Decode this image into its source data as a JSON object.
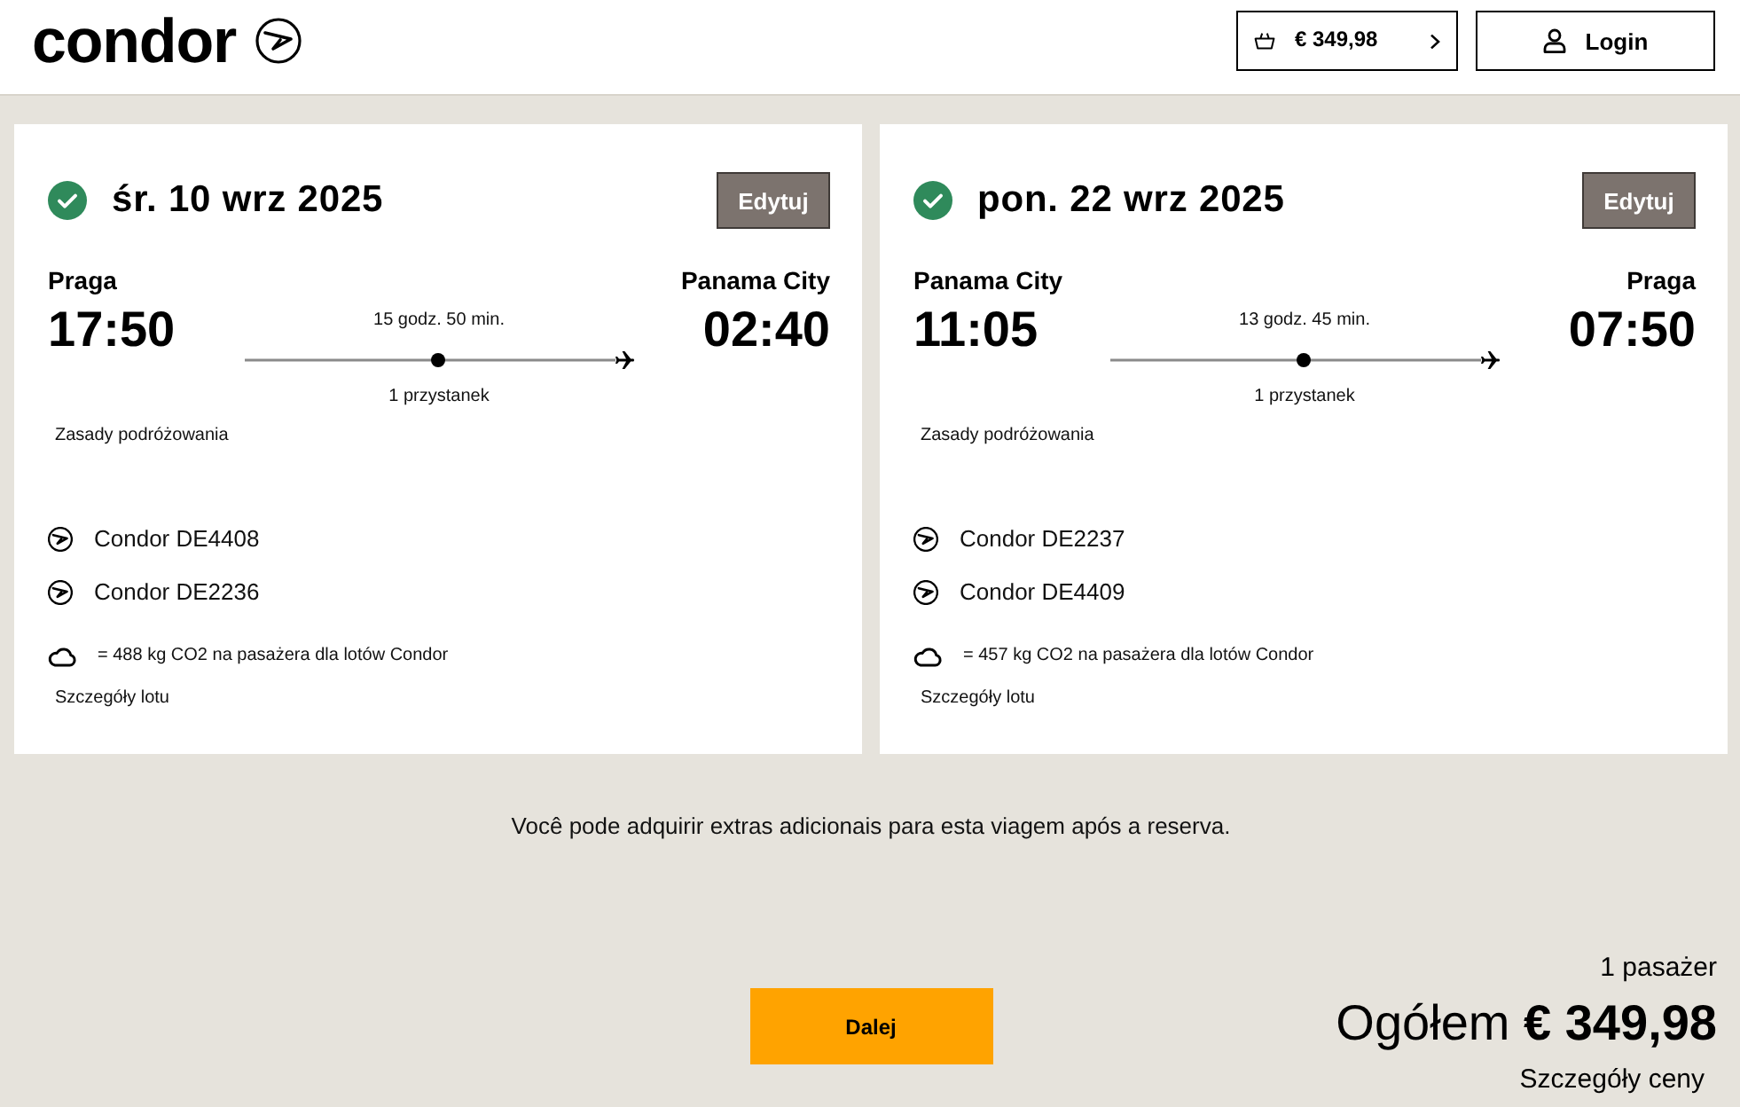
{
  "header": {
    "logo": "condor",
    "cart_total": "€ 349,98",
    "login": "Login"
  },
  "trips": [
    {
      "date": "śr. 10 wrz 2025",
      "edit": "Edytuj",
      "origin": {
        "city": "Praga",
        "time": "17:50"
      },
      "destination": {
        "city": "Panama City",
        "time": "02:40"
      },
      "duration": "15 godz. 50 min.",
      "stops": "1 przystanek",
      "rules_link": "Zasady podróżowania",
      "flights": [
        "Condor DE4408",
        "Condor DE2236"
      ],
      "co2": "= 488 kg CO2 na pasażera dla lotów Condor",
      "details_link": "Szczegóły lotu"
    },
    {
      "date": "pon. 22 wrz 2025",
      "edit": "Edytuj",
      "origin": {
        "city": "Panama City",
        "time": "11:05"
      },
      "destination": {
        "city": "Praga",
        "time": "07:50"
      },
      "duration": "13 godz. 45 min.",
      "stops": "1 przystanek",
      "rules_link": "Zasady podróżowania",
      "flights": [
        "Condor DE2237",
        "Condor DE4409"
      ],
      "co2": "= 457 kg CO2 na pasażera dla lotów Condor",
      "details_link": "Szczegóły lotu"
    }
  ],
  "note": "Você pode adquirir extras adicionais para esta viagem após a reserva.",
  "footer": {
    "continue": "Dalej",
    "passengers": "1 pasażer",
    "total": "Ogółem **€ 349,98**",
    "price_details": "Szczegóły ceny"
  }
}
